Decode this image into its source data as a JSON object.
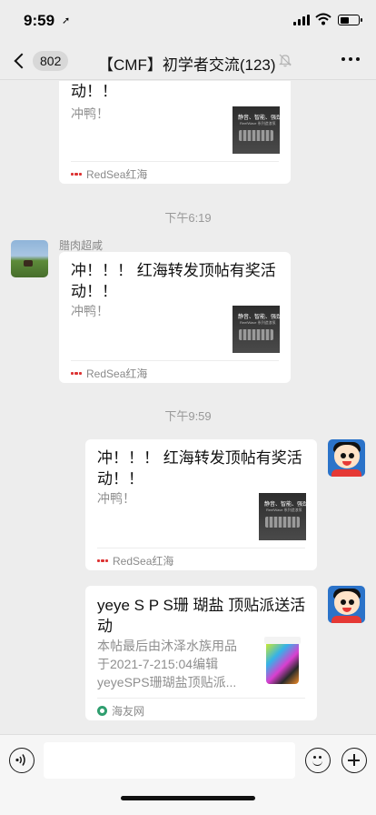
{
  "status_bar": {
    "time": "9:59",
    "location_glyph": "➚",
    "battery_level": 0.55
  },
  "nav": {
    "unread_count": "802",
    "title": "【CMF】初学者交流(123)",
    "mute_icon": "bell-slash-icon",
    "more_icon": "more-dots-icon"
  },
  "chat": {
    "card_partial": {
      "title_tail": "动！！",
      "desc": "冲鸭！",
      "thumb_text": "静音、智能、强劲",
      "thumb_sub": "ReefWave 系列造浪泵",
      "source": "RedSea红海"
    },
    "time_1": "下午6:19",
    "msg_2": {
      "sender": "腊肉超咸",
      "title": "冲！！！ 红海转发顶帖有奖活动！！",
      "desc": "冲鸭！",
      "thumb_text": "静音、智能、强劲",
      "thumb_sub": "ReefWave 系列造浪泵",
      "source": "RedSea红海"
    },
    "time_2": "下午9:59",
    "msg_3": {
      "title": "冲！！！ 红海转发顶帖有奖活动！！",
      "desc": "冲鸭！",
      "thumb_text": "静音、智能、强劲",
      "thumb_sub": "ReefWave 系列造浪泵",
      "source": "RedSea红海"
    },
    "msg_4": {
      "title": "yeye S P S珊 瑚盐 顶贴派送活动",
      "desc_line1": "本帖最后由沐泽水族用品",
      "desc_line2": "于2021-7-215:04编辑",
      "desc_line3": "yeyeSPS珊瑚盐顶贴派...",
      "source": "海友网"
    }
  },
  "input_bar": {
    "placeholder": "",
    "value": ""
  },
  "colors": {
    "background": "#ededed",
    "card": "#ffffff",
    "muted_text": "#999999"
  }
}
